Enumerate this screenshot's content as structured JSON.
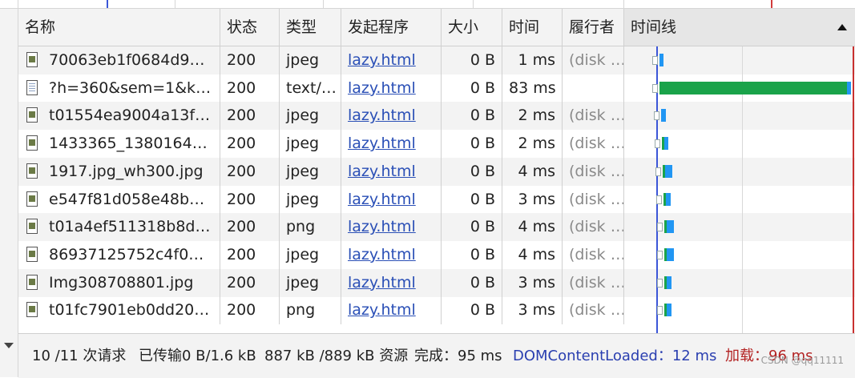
{
  "columns": {
    "name": "名称",
    "status": "状态",
    "type": "类型",
    "initiator": "发起程序",
    "size": "大小",
    "time": "时间",
    "fulfilled_by": "履行者",
    "timeline": "时间线"
  },
  "requests": [
    {
      "icon": "image-file-icon",
      "name": "70063eb1f0684d9387…",
      "status": "200",
      "type": "jpeg",
      "initiator": "lazy.html",
      "size": "0 B",
      "time": "1 ms",
      "fulfilled_by": "(disk …",
      "wait_ms": 0,
      "receive_ms": 1
    },
    {
      "icon": "document-file-icon",
      "name": "?h=360&sem=1&kw…",
      "status": "200",
      "type": "text/…",
      "initiator": "lazy.html",
      "size": "0 B",
      "time": "83 ms",
      "fulfilled_by": "",
      "wait_ms": 82,
      "receive_ms": 1
    },
    {
      "icon": "image-file-icon",
      "name": "t01554ea9004a13fad…",
      "status": "200",
      "type": "jpeg",
      "initiator": "lazy.html",
      "size": "0 B",
      "time": "2 ms",
      "fulfilled_by": "(disk …",
      "wait_ms": 0,
      "receive_ms": 2
    },
    {
      "icon": "image-file-icon",
      "name": "1433365_1380164541…",
      "status": "200",
      "type": "jpeg",
      "initiator": "lazy.html",
      "size": "0 B",
      "time": "2 ms",
      "fulfilled_by": "(disk …",
      "wait_ms": 1,
      "receive_ms": 1
    },
    {
      "icon": "image-file-icon",
      "name": "1917.jpg_wh300.jpg",
      "status": "200",
      "type": "jpeg",
      "initiator": "lazy.html",
      "size": "0 B",
      "time": "4 ms",
      "fulfilled_by": "(disk …",
      "wait_ms": 1,
      "receive_ms": 3
    },
    {
      "icon": "image-file-icon",
      "name": "e547f81d058e48b981…",
      "status": "200",
      "type": "jpeg",
      "initiator": "lazy.html",
      "size": "0 B",
      "time": "3 ms",
      "fulfilled_by": "(disk …",
      "wait_ms": 1,
      "receive_ms": 2
    },
    {
      "icon": "image-file-icon",
      "name": "t01a4ef511318b8d0e…",
      "status": "200",
      "type": "png",
      "initiator": "lazy.html",
      "size": "0 B",
      "time": "4 ms",
      "fulfilled_by": "(disk …",
      "wait_ms": 1,
      "receive_ms": 3
    },
    {
      "icon": "image-file-icon",
      "name": "86937125752c4f0b83…",
      "status": "200",
      "type": "jpeg",
      "initiator": "lazy.html",
      "size": "0 B",
      "time": "4 ms",
      "fulfilled_by": "(disk …",
      "wait_ms": 1,
      "receive_ms": 3
    },
    {
      "icon": "image-file-icon",
      "name": "Img308708801.jpg",
      "status": "200",
      "type": "jpeg",
      "initiator": "lazy.html",
      "size": "0 B",
      "time": "3 ms",
      "fulfilled_by": "(disk …",
      "wait_ms": 1,
      "receive_ms": 2
    },
    {
      "icon": "image-file-icon",
      "name": "t01fc7901eb0dd20f17…",
      "status": "200",
      "type": "png",
      "initiator": "lazy.html",
      "size": "0 B",
      "time": "3 ms",
      "fulfilled_by": "(disk …",
      "wait_ms": 1,
      "receive_ms": 2
    }
  ],
  "status_bar": {
    "requests": "10 /11 次请求",
    "transferred": "已传输0 B/1.6 kB",
    "resources": "887 kB /889 kB 资源",
    "finish": "完成：95 ms",
    "dom_content_loaded": "DOMContentLoaded：12 ms",
    "load": "加载：96 ms"
  },
  "watermark": "CSDN @qq11111",
  "colors": {
    "waiting": "#1aa34a",
    "receiving": "#2196f3",
    "dom_content_loaded_line": "#3b56d8",
    "load_line": "#c8302f",
    "link": "#2a4fb6"
  }
}
